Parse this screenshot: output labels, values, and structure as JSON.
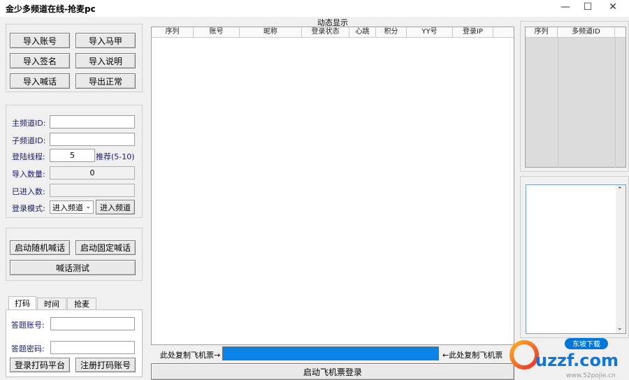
{
  "window": {
    "title": "金少多频道在线-抢麦pc",
    "minimize": "—",
    "maximize": "☐",
    "close": "✕"
  },
  "import_buttons": [
    "导入账号",
    "导入马甲",
    "导入签名",
    "导入说明",
    "导入喊话",
    "导出正常"
  ],
  "channel_form": {
    "main_channel_label": "主频道ID:",
    "main_channel_value": "",
    "sub_channel_label": "子频道ID:",
    "sub_channel_value": "",
    "threads_label": "登陆线程:",
    "threads_value": "5",
    "threads_hint": "推荐(5-10)",
    "import_count_label": "导入数量:",
    "import_count_value": "0",
    "entered_count_label": "已进入数:",
    "entered_count_value": "",
    "login_mode_label": "登录模式:",
    "login_mode_value": "进入频道",
    "enter_channel_button": "进入频道"
  },
  "shout": {
    "random_button": "启动随机喊话",
    "fixed_button": "启动固定喊话",
    "test_button": "喊话测试"
  },
  "tabs": [
    "打码",
    "时间",
    "抢麦"
  ],
  "captcha": {
    "account_label": "答题账号:",
    "account_value": "",
    "password_label": "答题密码:",
    "password_value": "",
    "login_button": "登录打码平台",
    "register_button": "注册打码账号"
  },
  "dynamic": {
    "title": "动态显示",
    "columns": [
      "序列",
      "账号",
      "昵称",
      "登录状态",
      "心跳",
      "积分",
      "YY号",
      "登录IP"
    ]
  },
  "bottom": {
    "left_hint": "此处复制飞机票→",
    "right_hint": "←此处复制飞机票",
    "ticket_value": "",
    "start_button": "启动飞机票登录"
  },
  "right_grid": {
    "columns": [
      "序列",
      "多频道ID"
    ]
  },
  "logo": {
    "brand": "uzzf.com",
    "tag": "东坡下载",
    "url": "www.52pojie.cn"
  },
  "colors": {
    "ticket_fill": "#0a84e8",
    "label_blue": "#1a1a6a"
  }
}
